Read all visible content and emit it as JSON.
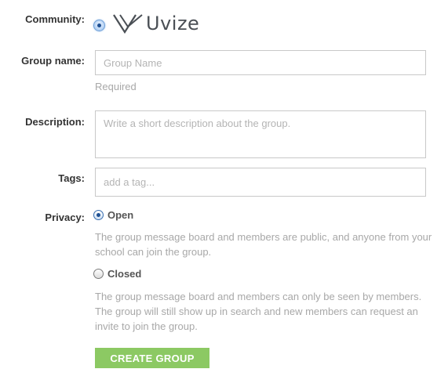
{
  "form": {
    "community": {
      "label": "Community:",
      "selected_value": "Uvize",
      "logo_icon": "uvize-chevron-logo"
    },
    "group_name": {
      "label": "Group name:",
      "value": "",
      "placeholder": "Group Name",
      "hint": "Required"
    },
    "description": {
      "label": "Description:",
      "value": "",
      "placeholder": "Write a short description about the group."
    },
    "tags": {
      "label": "Tags:",
      "value": "",
      "placeholder": "add a tag..."
    },
    "privacy": {
      "label": "Privacy:",
      "selected": "Open",
      "options": [
        {
          "label": "Open",
          "checked": true,
          "description": "The group message board and members are public, and anyone from your school can join the group."
        },
        {
          "label": "Closed",
          "checked": false,
          "description": "The group message board and members can only be seen by members. The group will still show up in search and new members can request an invite to join the group."
        }
      ]
    },
    "submit_label": "CREATE GROUP"
  },
  "colors": {
    "button": "#8cc963",
    "button_text": "#ffffff",
    "hint_text": "#a8a8a8",
    "label_text": "#333333",
    "input_border": "#c8c8c8"
  }
}
